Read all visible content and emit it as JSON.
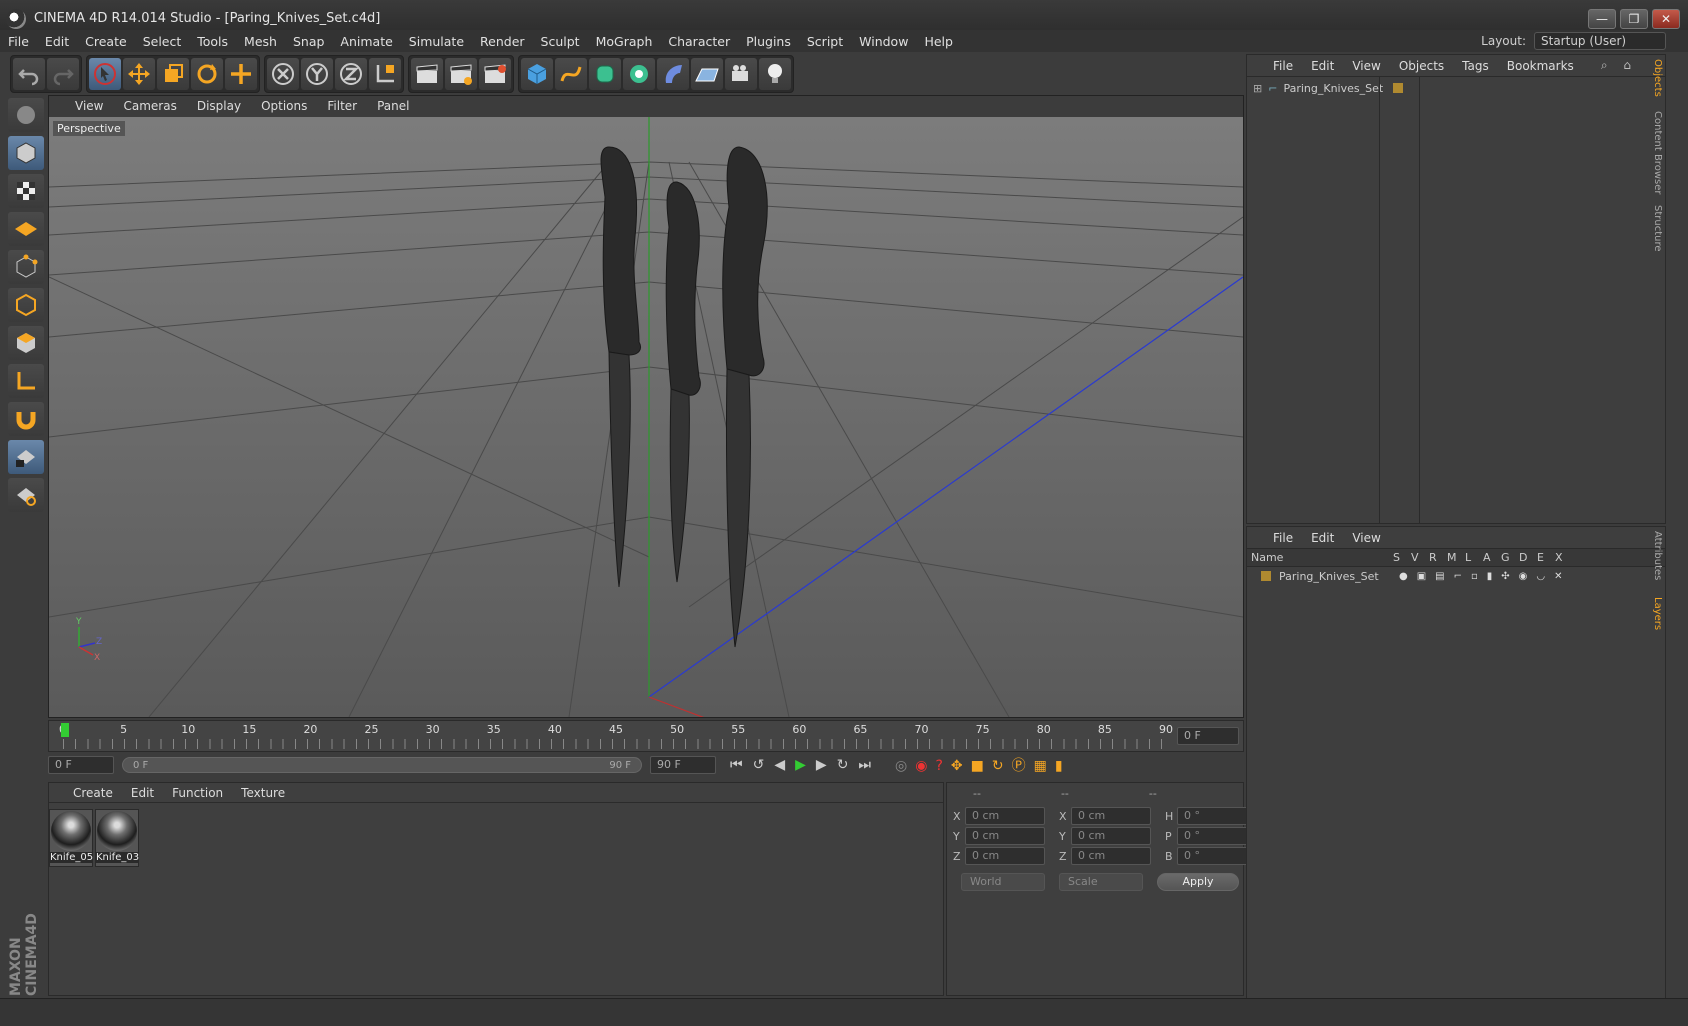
{
  "window": {
    "title": "CINEMA 4D R14.014 Studio - [Paring_Knives_Set.c4d]",
    "min": "—",
    "restore": "❐",
    "close": "✕"
  },
  "menu": [
    "File",
    "Edit",
    "Create",
    "Select",
    "Tools",
    "Mesh",
    "Snap",
    "Animate",
    "Simulate",
    "Render",
    "Sculpt",
    "MoGraph",
    "Character",
    "Plugins",
    "Script",
    "Window",
    "Help"
  ],
  "layout": {
    "label": "Layout:",
    "value": "Startup (User)"
  },
  "viewport": {
    "menu": [
      "View",
      "Cameras",
      "Display",
      "Options",
      "Filter",
      "Panel"
    ],
    "label": "Perspective",
    "axes": {
      "y": "Y",
      "z": "Z",
      "x": "X"
    }
  },
  "timeline": {
    "ticks": [
      "0",
      "5",
      "10",
      "15",
      "20",
      "25",
      "30",
      "35",
      "40",
      "45",
      "50",
      "55",
      "60",
      "65",
      "70",
      "75",
      "80",
      "85",
      "90"
    ],
    "current": "0 F",
    "start": "0 F",
    "range_start": "0 F",
    "range_end": "90 F",
    "end": "90 F"
  },
  "materials": {
    "menu": [
      "Create",
      "Edit",
      "Function",
      "Texture"
    ],
    "items": [
      {
        "name": "Knife_05"
      },
      {
        "name": "Knife_03"
      }
    ]
  },
  "coords": {
    "headers": [
      "--",
      "--",
      "--"
    ],
    "rows": [
      {
        "a": "X",
        "av": "0 cm",
        "b": "X",
        "bv": "0 cm",
        "c": "H",
        "cv": "0 °"
      },
      {
        "a": "Y",
        "av": "0 cm",
        "b": "Y",
        "bv": "0 cm",
        "c": "P",
        "cv": "0 °"
      },
      {
        "a": "Z",
        "av": "0 cm",
        "b": "Z",
        "bv": "0 cm",
        "c": "B",
        "cv": "0 °"
      }
    ],
    "mode1": "World",
    "mode2": "Scale",
    "apply": "Apply"
  },
  "objects": {
    "menu": [
      "File",
      "Edit",
      "View",
      "Objects",
      "Tags",
      "Bookmarks"
    ],
    "tree": [
      {
        "name": "Paring_Knives_Set"
      }
    ]
  },
  "layers": {
    "menu": [
      "File",
      "Edit",
      "View"
    ],
    "columns": [
      "Name",
      "S",
      "V",
      "R",
      "M",
      "L",
      "A",
      "G",
      "D",
      "E",
      "X"
    ],
    "rows": [
      {
        "name": "Paring_Knives_Set"
      }
    ]
  },
  "sidetabs": {
    "objects": "Objects",
    "content": "Content Browser",
    "structure": "Structure",
    "attributes": "Attributes",
    "layers": "Layers"
  },
  "brand": "MAXON CINEMA4D",
  "colors": {
    "accent": "#f5a623",
    "selection": "#5b7fa6",
    "viewport_bg": "#6a6a6a"
  }
}
